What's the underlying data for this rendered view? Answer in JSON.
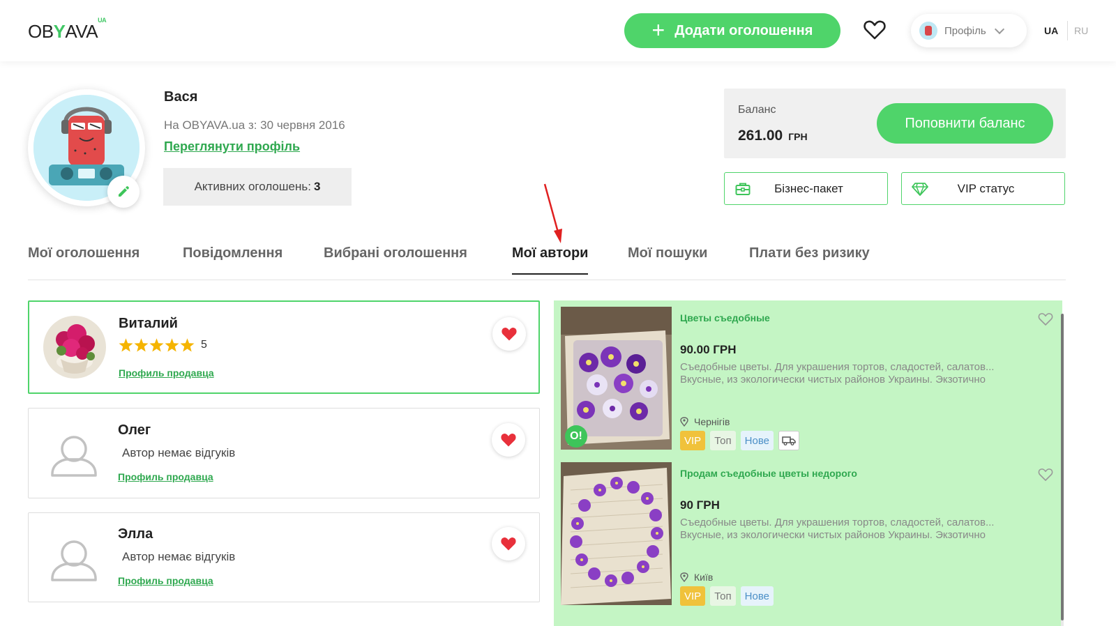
{
  "header": {
    "logo_text": "OBYAVA",
    "logo_suffix": "UA",
    "add_button_label": "Додати оголошення",
    "profile_label": "Профіль",
    "lang_active": "UA",
    "lang_other": "RU"
  },
  "profile": {
    "name": "Вася",
    "since": "На OBYAVA.ua з: 30 червня 2016",
    "view_link": "Переглянути профіль",
    "active_label": "Активних оголошень:",
    "active_count": "3"
  },
  "balance": {
    "label": "Баланс",
    "value": "261.00",
    "currency": "ГРН",
    "topup_label": "Поповнити баланс",
    "business_label": "Бізнес-пакет",
    "vip_label": "VIP статус"
  },
  "tabs": [
    {
      "label": "Мої оголошення"
    },
    {
      "label": "Повідомлення"
    },
    {
      "label": "Вибрані оголошення"
    },
    {
      "label": "Мої автори",
      "active": true
    },
    {
      "label": "Мої пошуки"
    },
    {
      "label": "Плати без ризику"
    }
  ],
  "authors": [
    {
      "name": "Виталий",
      "rating": "5",
      "stars": 5,
      "link": "Профиль продавца"
    },
    {
      "name": "Олег",
      "no_reviews": "Автор немає відгуків",
      "link": "Профиль продавца"
    },
    {
      "name": "Элла",
      "no_reviews": "Автор немає відгуків",
      "link": "Профиль продавца"
    }
  ],
  "listings": [
    {
      "title": "Цветы съедобные",
      "price": "90.00 ГРН",
      "desc_line1": "Съедобные цветы. Для украшения тортов, сладостей, салатов...",
      "desc_line2": "Вкусные, из экологически чистых районов Украины. Экзотично",
      "city": "Чернігів",
      "badge": "O!",
      "tags": [
        "VIP",
        "Топ",
        "Нове"
      ]
    },
    {
      "title": "Продам съедобные цветы недорого",
      "price": "90 ГРН",
      "desc_line1": "Съедобные цветы. Для украшения тортов, сладостей, салатов...",
      "desc_line2": "Вкусные, из экологически чистых районов Украины. Экзотично",
      "city": "Київ",
      "tags": [
        "VIP",
        "Топ",
        "Нове"
      ]
    }
  ],
  "colors": {
    "accent": "#4fd46a",
    "link": "#2fa84f",
    "heart": "#e8303b",
    "star": "#f5b400",
    "listing_bg": "#c4f5c4",
    "annotation_arrow": "#e02020"
  }
}
